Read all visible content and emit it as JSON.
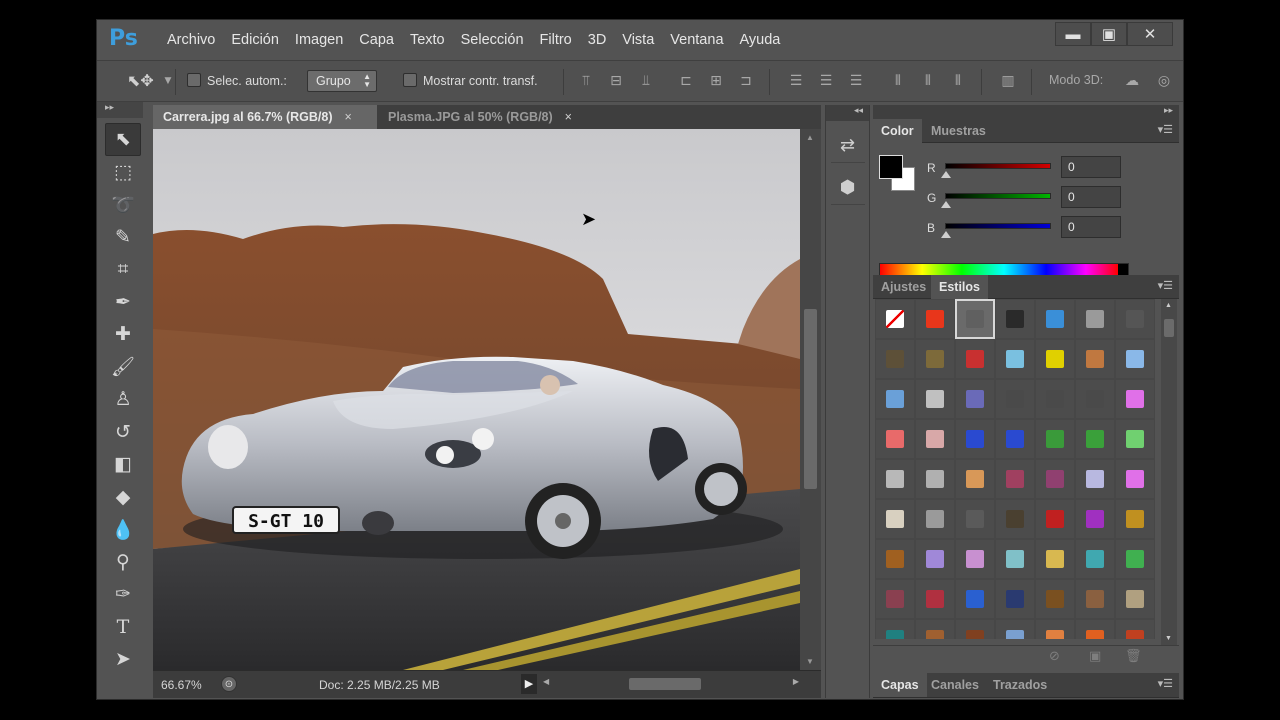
{
  "app": {
    "logo": "Ps"
  },
  "menu": [
    "Archivo",
    "Edición",
    "Imagen",
    "Capa",
    "Texto",
    "Selección",
    "Filtro",
    "3D",
    "Vista",
    "Ventana",
    "Ayuda"
  ],
  "window_controls": {
    "minimize": "▬",
    "maximize": "▣",
    "close": "✕"
  },
  "options": {
    "auto_select_label": "Selec. autom.:",
    "auto_select_value": "Grupo",
    "show_transform_label": "Mostrar contr. transf.",
    "mode_3d_label": "Modo 3D:"
  },
  "tabs": [
    {
      "label": "Carrera.jpg al 66.7% (RGB/8)",
      "close": "×"
    },
    {
      "label": "Plasma.JPG al 50% (RGB/8)",
      "close": "×"
    }
  ],
  "image": {
    "plate": "S-GT 10"
  },
  "status": {
    "zoom": "66.67%",
    "doc_size": "Doc: 2.25 MB/2.25 MB"
  },
  "color_panel": {
    "tabs": [
      "Color",
      "Muestras"
    ],
    "channels": [
      {
        "label": "R",
        "value": "0",
        "color": "#d40000"
      },
      {
        "label": "G",
        "value": "0",
        "color": "#00b400"
      },
      {
        "label": "B",
        "value": "0",
        "color": "#0000d8"
      }
    ],
    "foreground": "#000000",
    "background": "#ffffff"
  },
  "styles_panel": {
    "tabs": [
      "Ajustes",
      "Estilos"
    ],
    "swatches": [
      "#ffffff",
      "#e8361b",
      "#606060",
      "#2a2a2a",
      "#3a8fd8",
      "#9a9a9a",
      "#555555",
      "#5d5038",
      "#7d6a3a",
      "#c83030",
      "#7ac0e0",
      "#e0d000",
      "#c07840",
      "#8ab8e8",
      "#6aa0d8",
      "#c0c0c0",
      "#6a6ab8",
      "#4a4a4a",
      "#4a4a4a",
      "#4a4a4a",
      "#e070e8",
      "#e86a6a",
      "#d8a8a8",
      "#2a4ad0",
      "#2a4ad0",
      "#3a9a3a",
      "#3aa03a",
      "#70d070",
      "#b8b8b8",
      "#b0b0b0",
      "#d89858",
      "#a04060",
      "#904070",
      "#b8b8e0",
      "#e070e8",
      "#d8d0c0",
      "#9a9a9a",
      "#5a5a5a",
      "#4a4030",
      "#c02020",
      "#a030c0",
      "#c09020",
      "#a06020",
      "#a088d8",
      "#c890d0",
      "#80c0c8",
      "#d8b850",
      "#40a8b0",
      "#40b050",
      "#8a4050",
      "#b03040",
      "#2a60d0",
      "#2a3a70",
      "#7a5020",
      "#8a6040",
      "#b0a080",
      "#208080",
      "#a06030",
      "#804020",
      "#7aa0d0",
      "#e08040",
      "#e06020",
      "#c04020"
    ]
  },
  "layers_panel": {
    "tabs": [
      "Capas",
      "Canales",
      "Trazados"
    ]
  }
}
